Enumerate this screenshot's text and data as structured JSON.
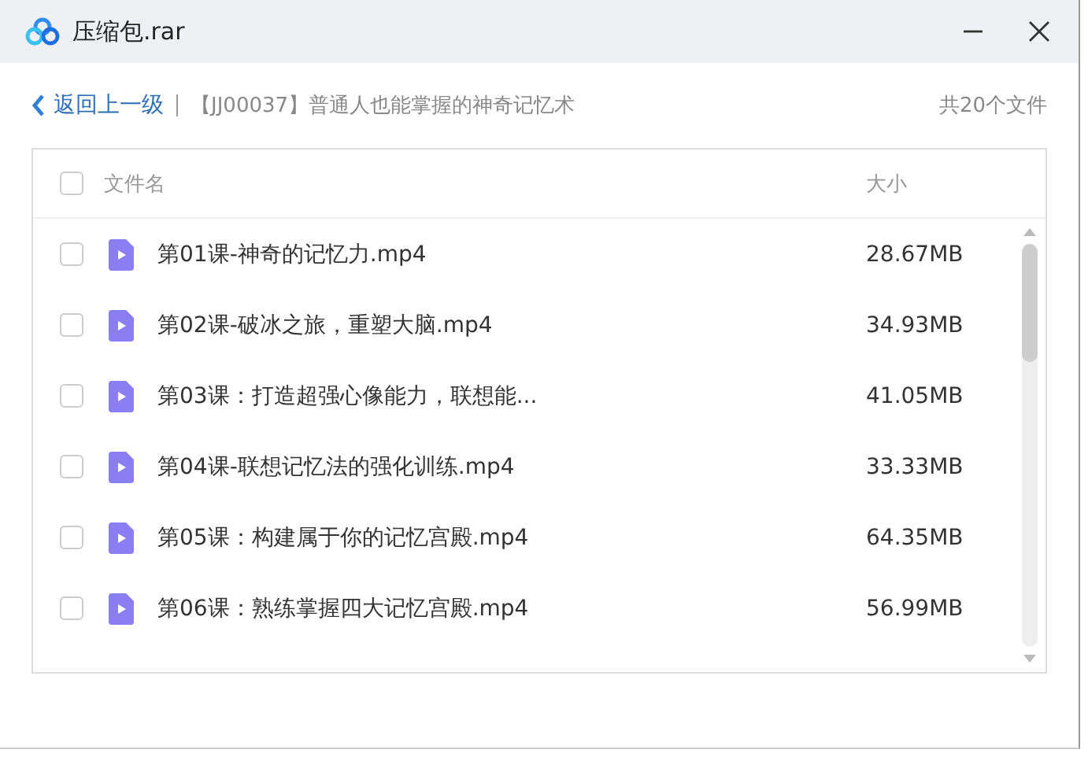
{
  "window": {
    "title": "压缩包.rar"
  },
  "nav": {
    "back": "返回上一级",
    "path": "【JJ00037】普通人也能掌握的神奇记忆术",
    "count": "共20个文件"
  },
  "table": {
    "columns": [
      "文件名",
      "大小"
    ],
    "select_all": {
      "checked": false
    },
    "rows": [
      {
        "name": "第01课-神奇的记忆力.mp4",
        "size": "28.67MB",
        "checked": false
      },
      {
        "name": "第02课-破冰之旅，重塑大脑.mp4",
        "size": "34.93MB",
        "checked": false
      },
      {
        "name": "第03课：打造超强心像能力，联想能...",
        "size": "41.05MB",
        "checked": false
      },
      {
        "name": "第04课-联想记忆法的强化训练.mp4",
        "size": "33.33MB",
        "checked": false
      },
      {
        "name": "第05课：构建属于你的记忆宫殿.mp4",
        "size": "64.35MB",
        "checked": false
      },
      {
        "name": "第06课：熟练掌握四大记忆宫殿.mp4",
        "size": "56.99MB",
        "checked": false
      }
    ]
  }
}
